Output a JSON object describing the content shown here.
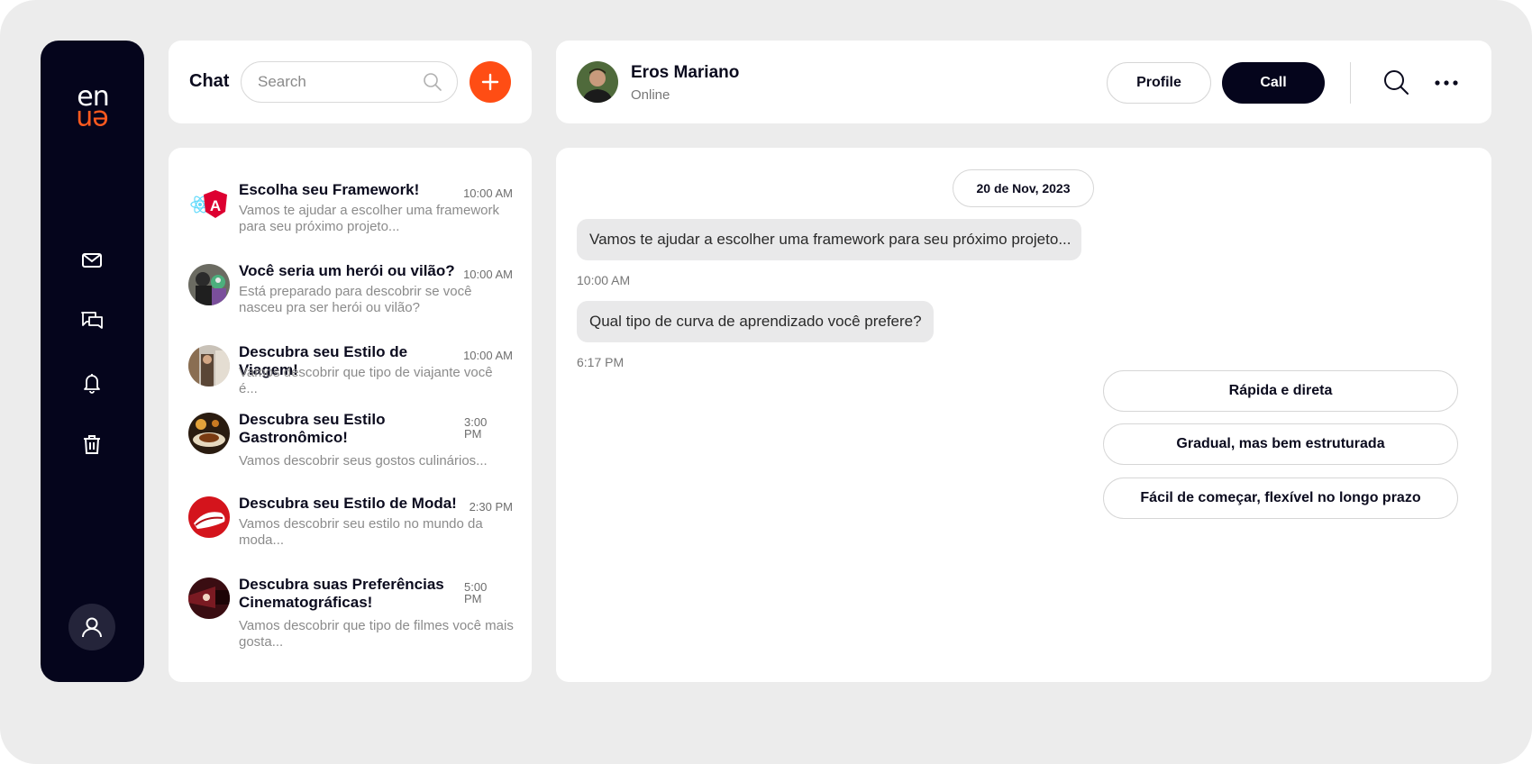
{
  "brand": {
    "logo_top": "en",
    "logo_bottom": "en"
  },
  "sidebar": {
    "items": [
      {
        "name": "mail",
        "icon": "mail-icon"
      },
      {
        "name": "chats",
        "icon": "chat-bubbles-icon"
      },
      {
        "name": "notifications",
        "icon": "bell-icon"
      },
      {
        "name": "trash",
        "icon": "trash-icon"
      }
    ],
    "profile_icon": "user-icon"
  },
  "chat_panel": {
    "title": "Chat",
    "search_placeholder": "Search",
    "add_icon": "plus-icon"
  },
  "chats": [
    {
      "title": "Escolha seu Framework!",
      "time": "10:00 AM",
      "preview": "Vamos te ajudar a escolher uma framework para seu próximo projeto..."
    },
    {
      "title": "Você seria um herói ou vilão?",
      "time": "10:00 AM",
      "preview": "Está preparado para descobrir se você nasceu pra ser herói ou vilão?"
    },
    {
      "title": "Descubra seu Estilo de Viagem!",
      "time": "10:00 AM",
      "preview": "Vamos descobrir que tipo de viajante você é..."
    },
    {
      "title": "Descubra seu Estilo Gastronômico!",
      "time": "3:00 PM",
      "preview": "Vamos descobrir seus gostos culinários..."
    },
    {
      "title": "Descubra seu Estilo de Moda!",
      "time": "2:30 PM",
      "preview": "Vamos descobrir seu estilo no mundo da moda..."
    },
    {
      "title": "Descubra suas Preferências Cinematográficas!",
      "time": "5:00 PM",
      "preview": "Vamos descobrir que tipo de filmes você mais gosta..."
    }
  ],
  "conversation": {
    "contact_name": "Eros Mariano",
    "contact_status": "Online",
    "profile_label": "Profile",
    "call_label": "Call",
    "date": "20 de Nov, 2023",
    "messages": [
      {
        "text": "Vamos te ajudar a escolher uma framework para seu próximo projeto...",
        "time": "10:00 AM"
      },
      {
        "text": "Qual tipo de curva de aprendizado você prefere?",
        "time": "6:17 PM"
      }
    ],
    "options": [
      "Rápida e direta",
      "Gradual, mas bem estruturada",
      "Fácil de começar, flexível no longo prazo"
    ]
  },
  "colors": {
    "accent": "#ff4d14",
    "dark": "#05051c",
    "background": "#ececec"
  }
}
